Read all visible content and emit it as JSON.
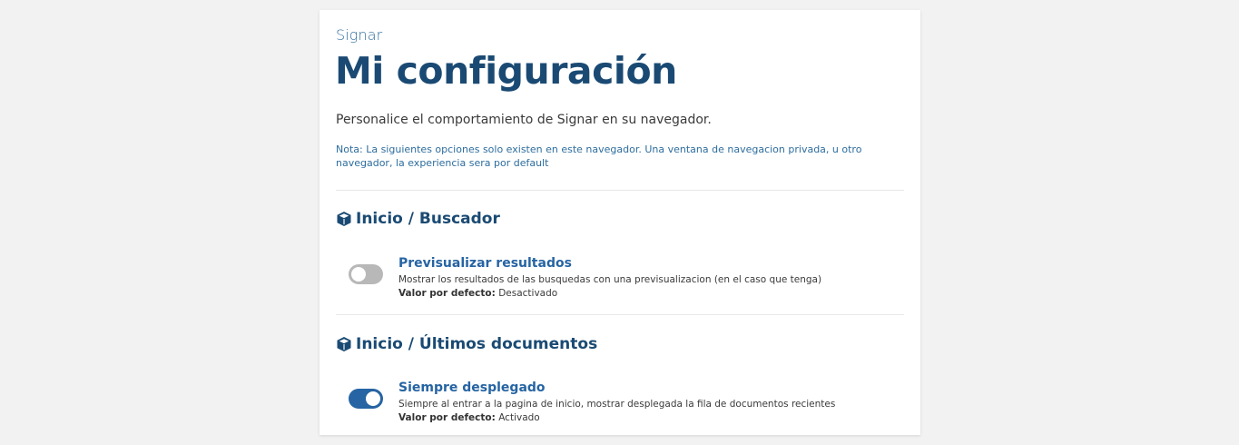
{
  "header": {
    "eyebrow": "Signar",
    "title": "Mi configuración",
    "subtitle": "Personalice el comportamiento de Signar en su navegador.",
    "note": "Nota: La siguientes opciones solo existen en este navegador. Una ventana de navegacion privada, u otro navegador, la experiencia sera por default"
  },
  "sections": [
    {
      "title": "Inicio / Buscador",
      "icon": "cube-icon",
      "setting": {
        "title": "Previsualizar resultados",
        "description": "Mostrar los resultados de las busquedas con una previsualizacion (en el caso que tenga)",
        "default_label": "Valor por defecto:",
        "default_value": "Desactivado",
        "enabled": false
      }
    },
    {
      "title": "Inicio / Últimos documentos",
      "icon": "cube-icon",
      "setting": {
        "title": "Siempre desplegado",
        "description": "Siempre al entrar a la pagina de inicio, mostrar desplegada la fila de documentos recientes",
        "default_label": "Valor por defecto:",
        "default_value": "Activado",
        "enabled": true
      }
    }
  ],
  "colors": {
    "primary": "#1a4a73",
    "accent": "#2664a3",
    "toggle_off": "#b8b8b8"
  }
}
